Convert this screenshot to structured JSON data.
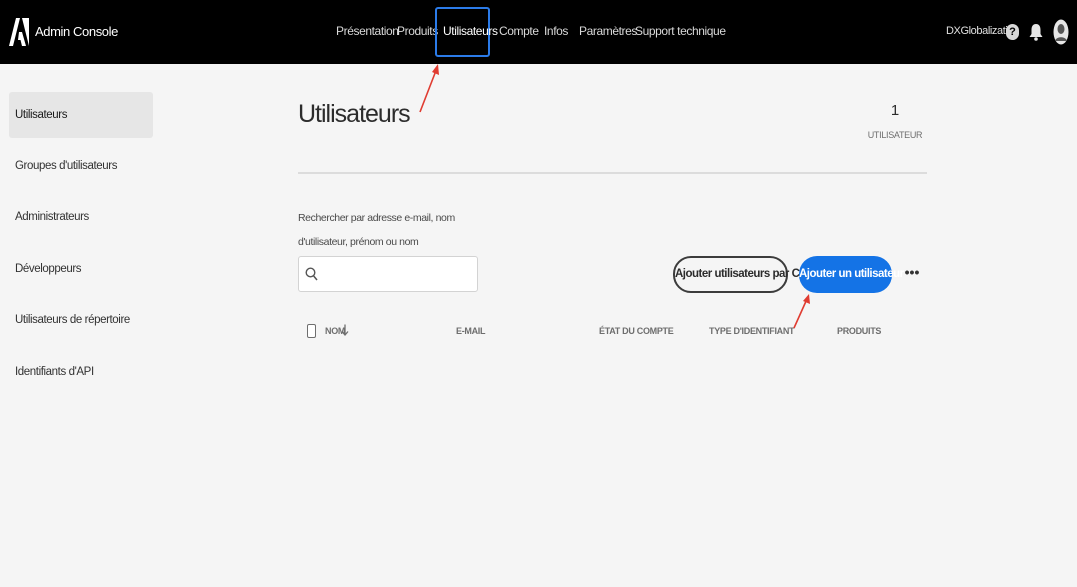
{
  "header": {
    "app_title": "Admin Console",
    "nav": [
      {
        "label": "Présentation"
      },
      {
        "label": "Produits"
      },
      {
        "label": "Utilisateurs",
        "active": true
      },
      {
        "label": "Compte"
      },
      {
        "label": "Infos"
      },
      {
        "label": "Paramètres"
      },
      {
        "label": "Support technique"
      }
    ],
    "org_name": "DXGlobalization",
    "help_glyph": "?",
    "icons": [
      "adobe-logo-icon",
      "help-icon",
      "bell-icon",
      "avatar-icon"
    ]
  },
  "sidebar": {
    "items": [
      {
        "label": "Utilisateurs",
        "active": true
      },
      {
        "label": "Groupes d'utilisateurs"
      },
      {
        "label": "Administrateurs"
      },
      {
        "label": "Développeurs"
      },
      {
        "label": "Utilisateurs de répertoire"
      },
      {
        "label": "Identifiants d'API"
      }
    ]
  },
  "main": {
    "title": "Utilisateurs",
    "count": "1",
    "count_label": "UTILISATEUR",
    "search": {
      "label": "Rechercher par adresse e-mail, nom d'utilisateur, prénom ou nom",
      "value": "",
      "placeholder": ""
    },
    "buttons": {
      "add_csv": "Ajouter utilisateurs par CSV",
      "add_user": "Ajouter un utilisateur",
      "more": "•••"
    },
    "table": {
      "columns": [
        "NOM",
        "E-MAIL",
        "ÉTAT DU COMPTE",
        "TYPE D'IDENTIFIANT",
        "PRODUITS"
      ],
      "sort_column": "NOM",
      "sort_direction": "descending"
    }
  },
  "colors": {
    "topbar": "#000000",
    "accent": "#1473e6",
    "highlight_border": "#2b7be8",
    "annotation_arrow": "#e03c31",
    "background": "#f5f5f5"
  }
}
